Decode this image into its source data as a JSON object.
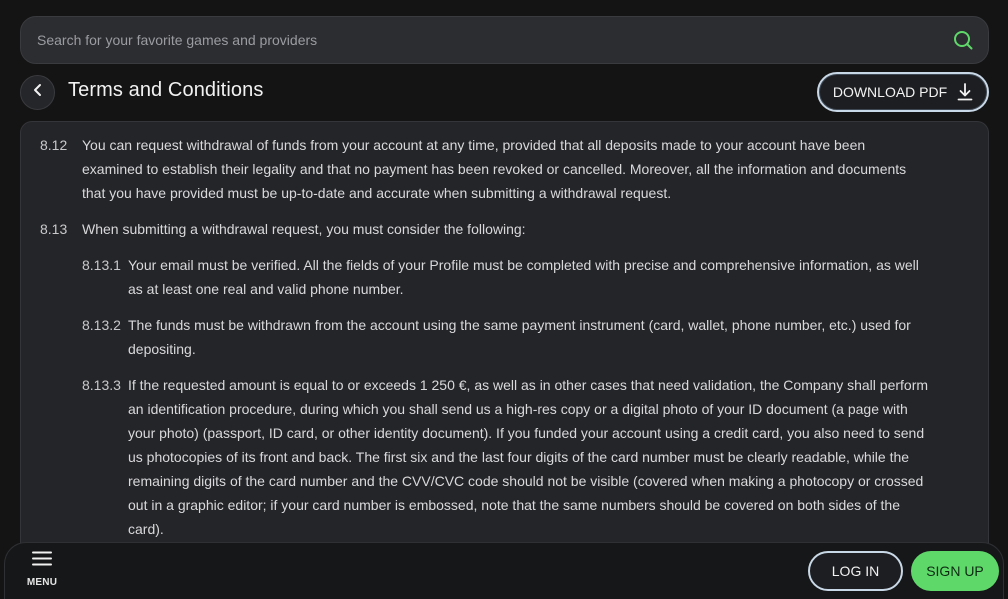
{
  "search": {
    "placeholder": "Search for your favorite games and providers",
    "icon": "search-icon",
    "icon_color": "#5fd86a"
  },
  "header": {
    "back_icon": "chevron-left-icon",
    "title": "Terms and Conditions",
    "download_label": "DOWNLOAD PDF",
    "download_icon": "download-icon"
  },
  "clauses": [
    {
      "num": "8.12",
      "lines": [
        "You can request withdrawal of funds from your account at any time, provided that all deposits made to your account have been",
        "examined to establish their legality and that no payment has been revoked or cancelled. Moreover, all the information and documents",
        "that you have provided must be up-to-date and accurate when submitting a withdrawal request."
      ]
    },
    {
      "num": "8.13",
      "lines": [
        "When submitting a withdrawal request, you must consider the following:"
      ]
    },
    {
      "num": "8.13.1",
      "lines": [
        "Your email must be verified. All the fields of your Profile must be completed with precise and comprehensive information, as well",
        "as at least one real and valid phone number."
      ]
    },
    {
      "num": "8.13.2",
      "lines": [
        "The funds must be withdrawn from the account using the same payment instrument (card, wallet, phone number, etc.) used for",
        "depositing."
      ]
    },
    {
      "num": "8.13.3",
      "lines": [
        "If the requested amount is equal to or exceeds 1 250 €, as well as in other cases that need validation, the Company shall perform",
        "an identification procedure, during which you shall send us a high-res copy or a digital photo of your ID document (a page with",
        "your photo) (passport, ID card, or other identity document). If you funded your account using a credit card, you also need to send",
        "us photocopies of its front and back. The first six and the last four digits of the card number must be clearly readable, while the",
        "remaining digits of the card number and the CVV/CVC code should not be visible (covered when making a photocopy or crossed",
        "out in a graphic editor; if your card number is embossed, note that the same numbers should be covered on both sides of the",
        "card)."
      ]
    }
  ],
  "bottom": {
    "menu_icon": "hamburger-icon",
    "menu_label": "MENU",
    "login_label": "LOG IN",
    "signup_label": "SIGN UP",
    "signup_color": "#5fd86a"
  }
}
